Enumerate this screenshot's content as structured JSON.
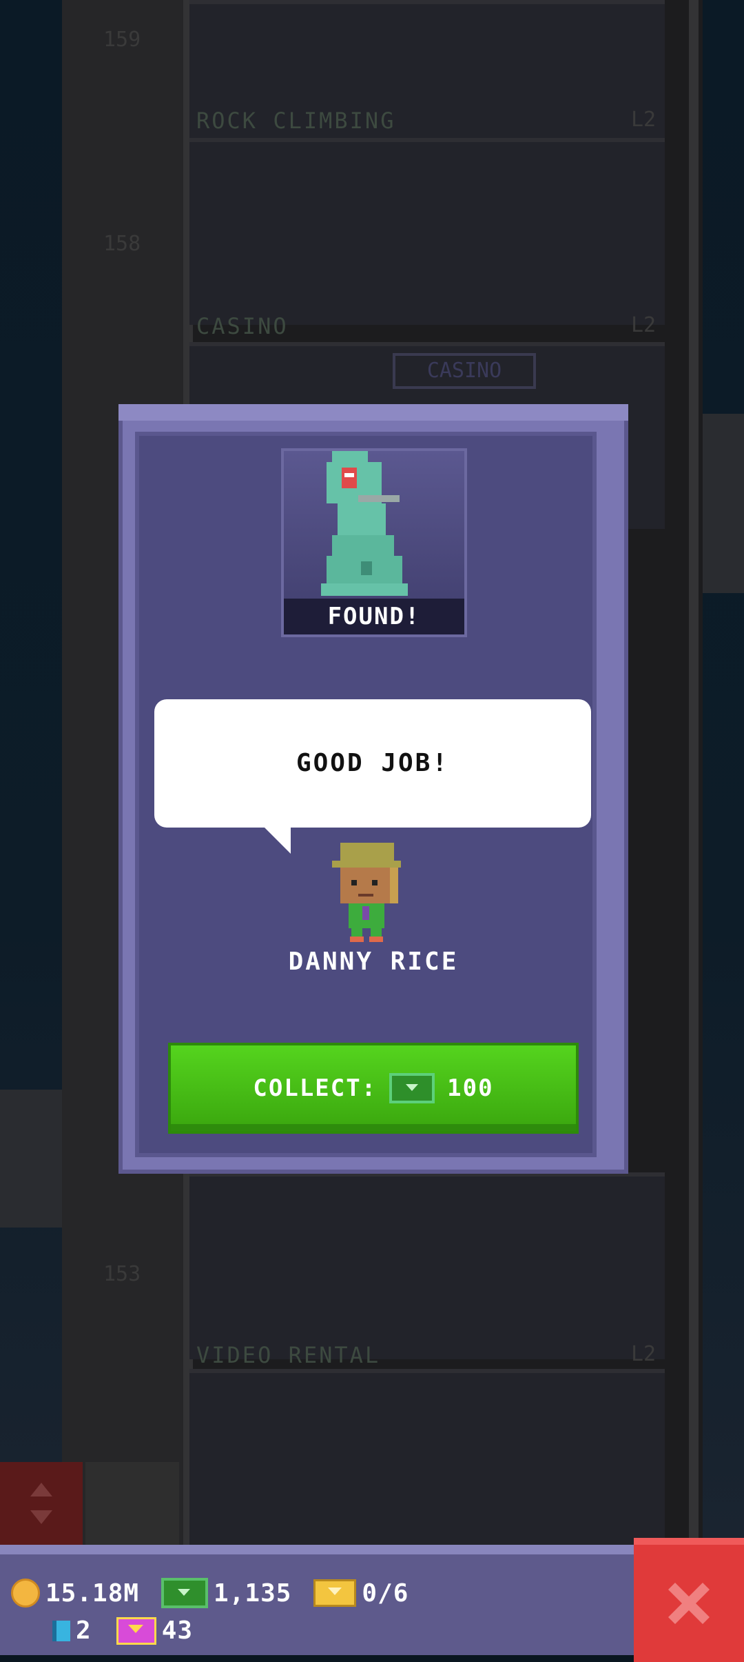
{
  "background": {
    "floors": [
      {
        "number": "159",
        "label": "ROCK CLIMBING",
        "level": "L2"
      },
      {
        "number": "158",
        "label": "CASINO",
        "level": "L2",
        "sign": "CASINO"
      },
      {
        "number": "153",
        "label": "VIDEO RENTAL",
        "level": "L2"
      }
    ]
  },
  "modal": {
    "badge_label": "FOUND!",
    "speech": "GOOD JOB!",
    "character_name": "DANNY RICE",
    "collect_label": "COLLECT:",
    "collect_amount": "100"
  },
  "hud": {
    "coins": "15.18M",
    "bux": "1,135",
    "tickets": "0/6",
    "keys": "2",
    "vip": "43"
  },
  "colors": {
    "modal": "#7a76b2",
    "collect_button": "#4cc414",
    "close_button": "#e03a3a"
  }
}
